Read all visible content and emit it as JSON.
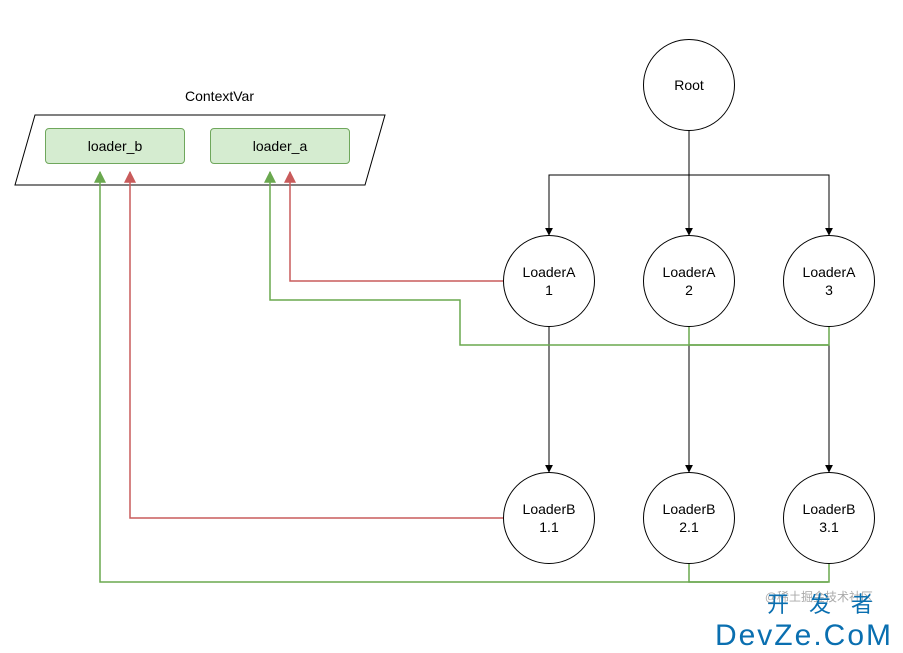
{
  "contextVar": {
    "title": "ContextVar",
    "boxes": [
      "loader_b",
      "loader_a"
    ]
  },
  "tree": {
    "root": "Root",
    "level1": [
      {
        "name": "LoaderA",
        "id": "1"
      },
      {
        "name": "LoaderA",
        "id": "2"
      },
      {
        "name": "LoaderA",
        "id": "3"
      }
    ],
    "level2": [
      {
        "name": "LoaderB",
        "id": "1.1"
      },
      {
        "name": "LoaderB",
        "id": "2.1"
      },
      {
        "name": "LoaderB",
        "id": "3.1"
      }
    ]
  },
  "colors": {
    "red": "#c95b5b",
    "green": "#6aa84f",
    "black": "#000000",
    "box_fill": "#d5ecd0",
    "box_border": "#6fa75c"
  },
  "watermark": "@稀土掘金技术社区",
  "brand_top": "开发者",
  "brand_bottom": "DevZe.CoM"
}
